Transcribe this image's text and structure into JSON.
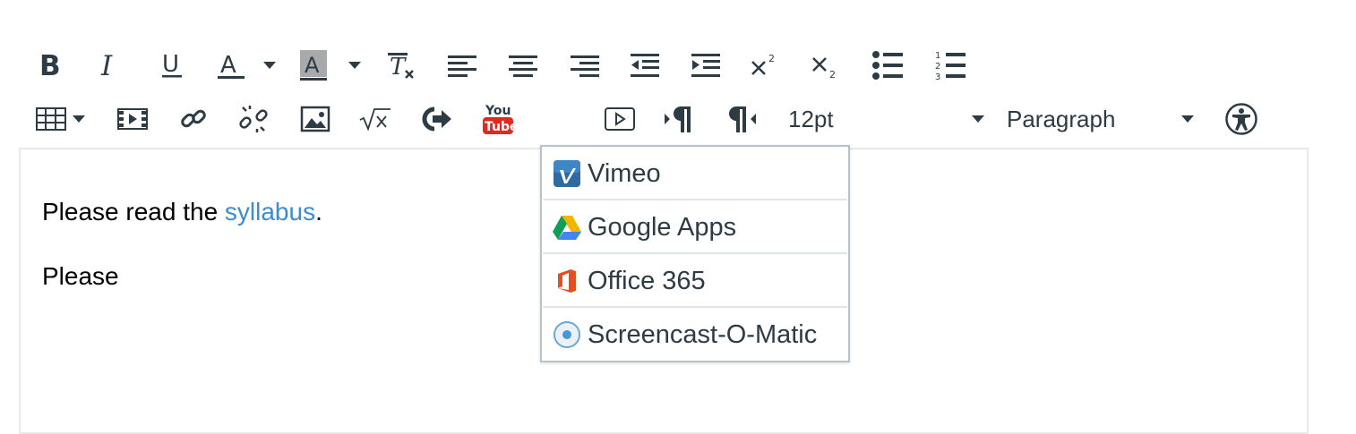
{
  "toolbar": {
    "font_size": "12pt",
    "block_format": "Paragraph"
  },
  "editor": {
    "paragraph1_prefix": "Please read the ",
    "paragraph1_link": "syllabus",
    "paragraph1_suffix": ".",
    "paragraph2": "Please"
  },
  "lti_menu": {
    "items": [
      {
        "label": "Vimeo",
        "icon": "vimeo-icon"
      },
      {
        "label": "Google Apps",
        "icon": "google-drive-icon"
      },
      {
        "label": "Office 365",
        "icon": "office365-icon"
      },
      {
        "label": "Screencast-O-Matic",
        "icon": "screencast-icon"
      }
    ]
  },
  "colors": {
    "accent_active_border": "#e0533a",
    "link": "#3b8cd0",
    "icon": "#2d3b45"
  }
}
